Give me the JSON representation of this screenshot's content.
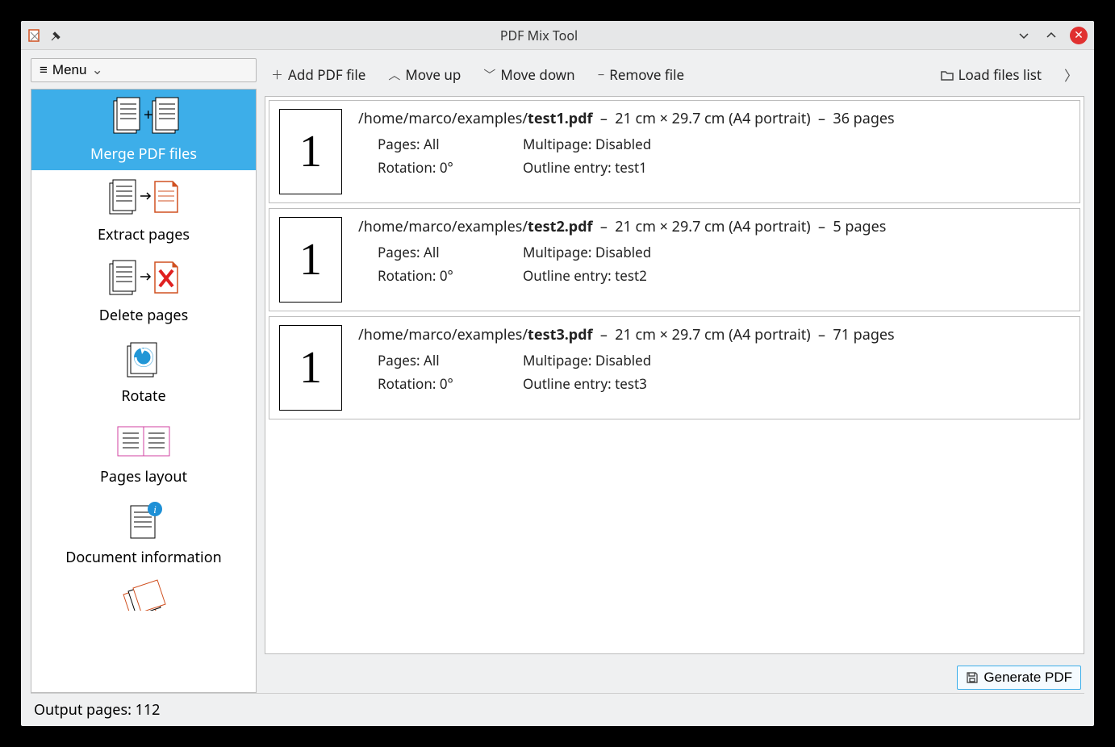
{
  "window": {
    "title": "PDF Mix Tool"
  },
  "menu_button": "Menu",
  "sidebar": {
    "items": [
      {
        "label": "Merge PDF files"
      },
      {
        "label": "Extract pages"
      },
      {
        "label": "Delete pages"
      },
      {
        "label": "Rotate"
      },
      {
        "label": "Pages layout"
      },
      {
        "label": "Document information"
      }
    ]
  },
  "toolbar": {
    "add": "Add PDF file",
    "move_up": "Move up",
    "move_down": "Move down",
    "remove": "Remove file",
    "load_list": "Load files list"
  },
  "files": [
    {
      "thumb": "1",
      "dir": "/home/marco/examples/",
      "name": "test1.pdf",
      "dims": "21 cm × 29.7 cm (A4 portrait)",
      "pages": "36 pages",
      "pages_sel": "Pages: All",
      "multipage": "Multipage: Disabled",
      "rotation": "Rotation: 0°",
      "outline": "Outline entry: test1"
    },
    {
      "thumb": "1",
      "dir": "/home/marco/examples/",
      "name": "test2.pdf",
      "dims": "21 cm × 29.7 cm (A4 portrait)",
      "pages": "5 pages",
      "pages_sel": "Pages: All",
      "multipage": "Multipage: Disabled",
      "rotation": "Rotation: 0°",
      "outline": "Outline entry: test2"
    },
    {
      "thumb": "1",
      "dir": "/home/marco/examples/",
      "name": "test3.pdf",
      "dims": "21 cm × 29.7 cm (A4 portrait)",
      "pages": "71 pages",
      "pages_sel": "Pages: All",
      "multipage": "Multipage: Disabled",
      "rotation": "Rotation: 0°",
      "outline": "Outline entry: test3"
    }
  ],
  "generate": "Generate PDF",
  "status": "Output pages: 112"
}
